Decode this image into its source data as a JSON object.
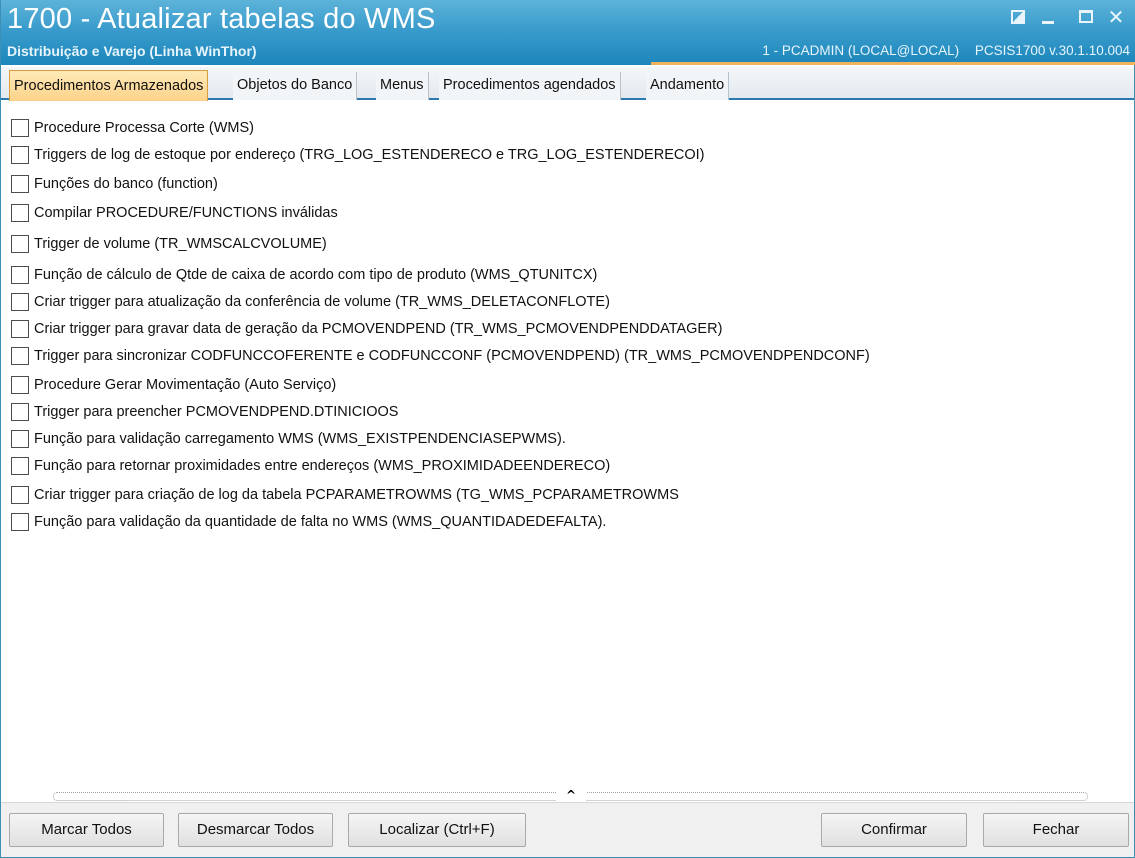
{
  "window": {
    "title": "1700 - Atualizar tabelas do WMS",
    "subtitle": "Distribuição e Varejo (Linha WinThor)",
    "user_info": "1 - PCADMIN (LOCAL@LOCAL)",
    "routine_info": "PCSIS1700  v.30.1.10.004",
    "controls": {
      "restore_icon": "restore-icon",
      "minimize_icon": "minimize-icon",
      "maximize_icon": "maximize-icon",
      "close_symbol": "✕"
    }
  },
  "tabs": [
    {
      "label": "Procedimentos Armazenados",
      "active": true
    },
    {
      "label": "Objetos do Banco",
      "active": false
    },
    {
      "label": "Menus",
      "active": false
    },
    {
      "label": "Procedimentos agendados",
      "active": false
    },
    {
      "label": "Andamento",
      "active": false
    }
  ],
  "procedures": [
    {
      "label": "Procedure Processa Corte (WMS)",
      "checked": false
    },
    {
      "label": "Triggers de log de estoque por endereço (TRG_LOG_ESTENDERECO e TRG_LOG_ESTENDERECOI)",
      "checked": false
    },
    {
      "label": "Funções do banco (function)",
      "checked": false
    },
    {
      "label": "Compilar PROCEDURE/FUNCTIONS inválidas",
      "checked": false
    },
    {
      "label": "Trigger de volume (TR_WMSCALCVOLUME)",
      "checked": false
    },
    {
      "label": "Função de cálculo de Qtde de caixa de acordo com tipo de produto (WMS_QTUNITCX)",
      "checked": false
    },
    {
      "label": "Criar trigger para atualização da conferência de volume (TR_WMS_DELETACONFLOTE)",
      "checked": false
    },
    {
      "label": "Criar trigger para gravar data de geração da PCMOVENDPEND (TR_WMS_PCMOVENDPENDDATAGER)",
      "checked": false
    },
    {
      "label": "Trigger para sincronizar CODFUNCCOFERENTE e CODFUNCCONF (PCMOVENDPEND) (TR_WMS_PCMOVENDPENDCONF)",
      "checked": false
    },
    {
      "label": "Procedure Gerar Movimentação (Auto Serviço)",
      "checked": false
    },
    {
      "label": "Trigger para preencher PCMOVENDPEND.DTINICIOOS",
      "checked": false
    },
    {
      "label": "Função para validação carregamento WMS (WMS_EXISTPENDENCIASEPWMS).",
      "checked": false
    },
    {
      "label": "Função para retornar proximidades entre endereços (WMS_PROXIMIDADEENDERECO)",
      "checked": false
    },
    {
      "label": "Criar trigger para criação de log da tabela PCPARAMETROWMS (TG_WMS_PCPARAMETROWMS",
      "checked": false
    },
    {
      "label": "Função para validação da quantidade de falta no WMS (WMS_QUANTIDADEDEFALTA).",
      "checked": false
    }
  ],
  "splitter": {
    "symbol": "^"
  },
  "footer": {
    "marcar_todos": "Marcar Todos",
    "desmarcar_todos": "Desmarcar Todos",
    "localizar": "Localizar (Ctrl+F)",
    "confirmar": "Confirmar",
    "fechar": "Fechar"
  },
  "colors": {
    "titlebar_top": "#5db3d9",
    "titlebar_bottom": "#1d86bb",
    "active_tab": "#fcd38a",
    "accent_line": "#f0b25a"
  }
}
